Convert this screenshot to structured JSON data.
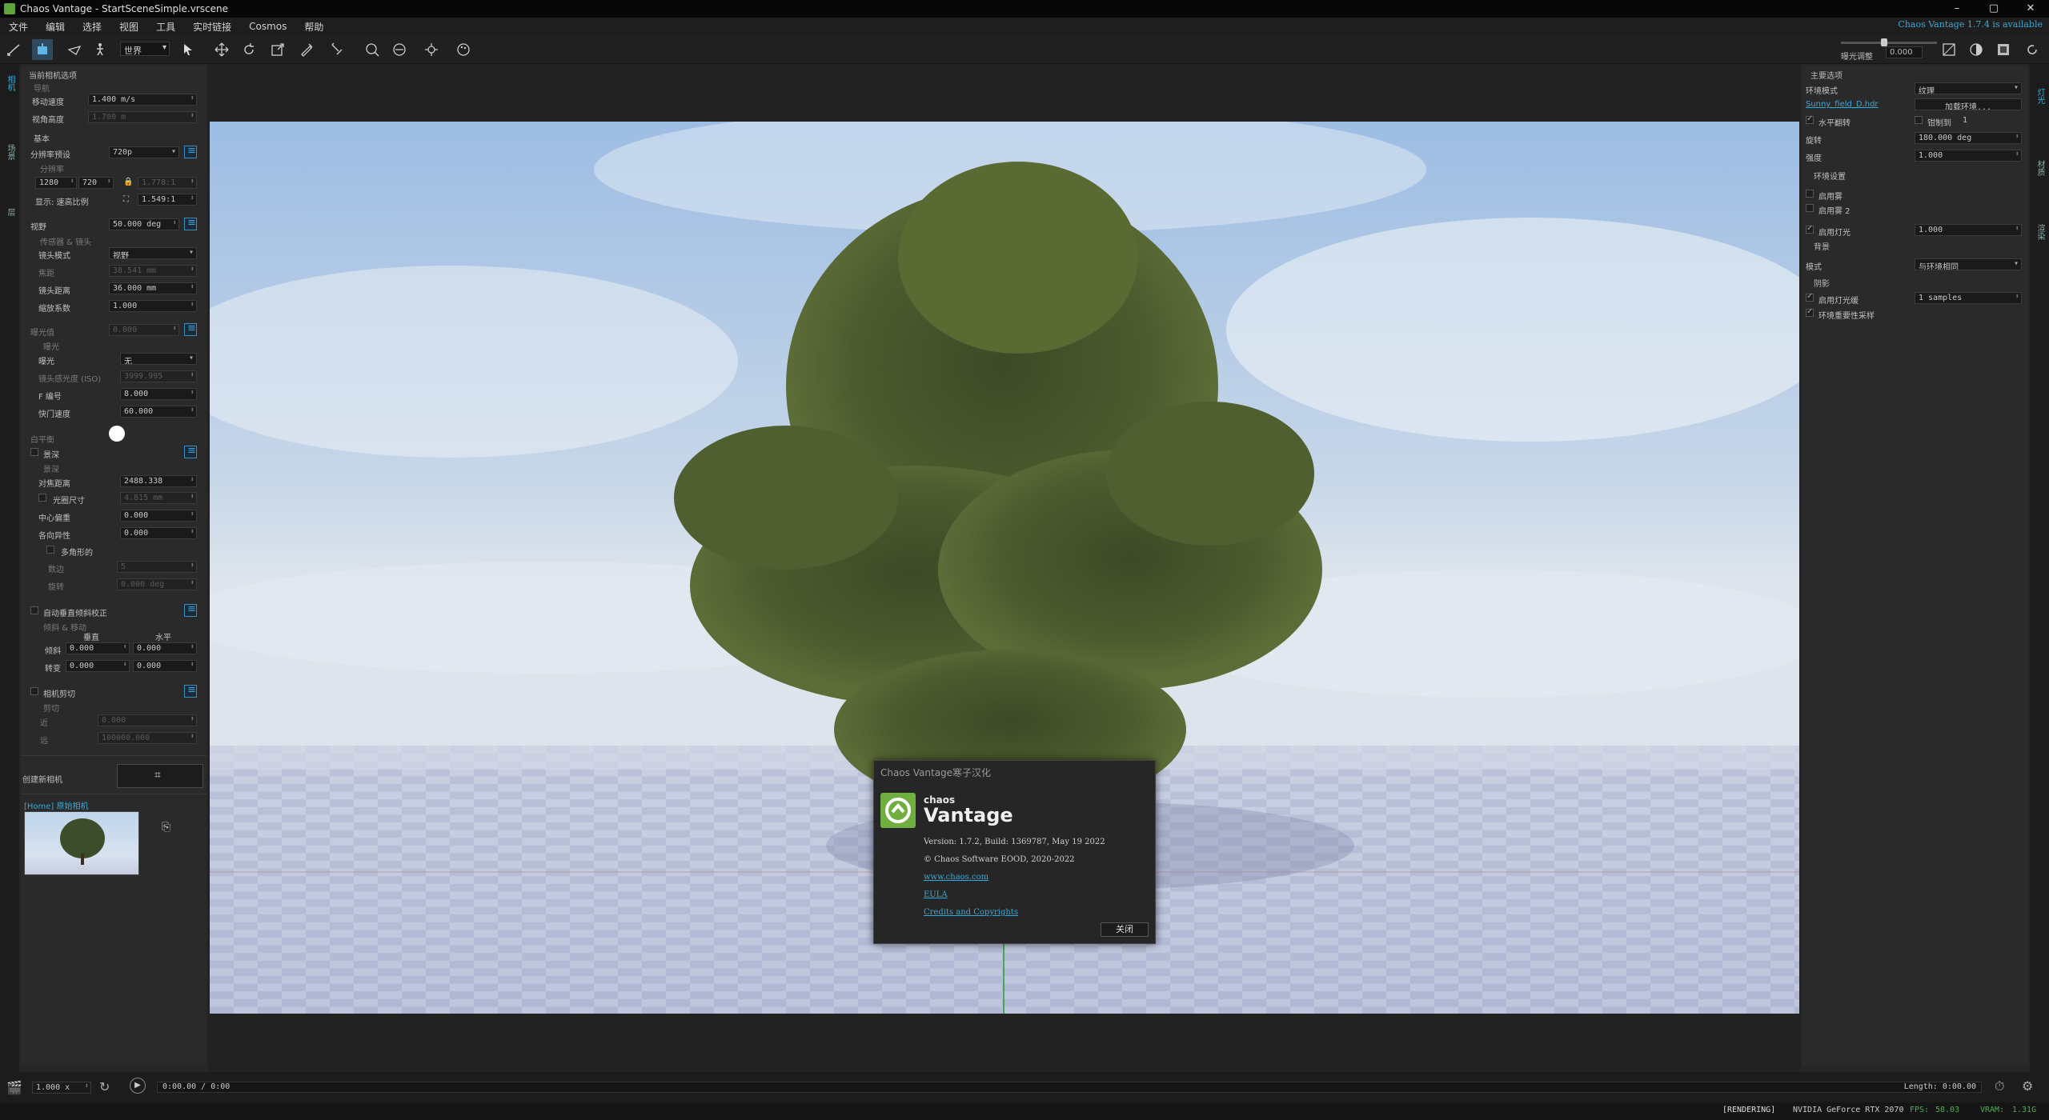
{
  "window": {
    "title": "Chaos Vantage - StartSceneSimple.vrscene",
    "minimize": "–",
    "maximize": "▢",
    "close": "✕"
  },
  "menu": [
    "文件",
    "编辑",
    "选择",
    "视图",
    "工具",
    "实时链接",
    "Cosmos",
    "帮助"
  ],
  "update_notice": "Chaos Vantage 1.7.4 is available",
  "toolbar": {
    "view_select": "世界",
    "exposure_label": "曝光调整",
    "exposure_value": "0.000"
  },
  "left_tabs": [
    "相机",
    "场景",
    "层"
  ],
  "right_tabs": [
    "灯光",
    "材质",
    "渲染"
  ],
  "left_panel": {
    "section_title": "当前相机选项",
    "nav": {
      "header": "导航",
      "move_speed_label": "移动速度",
      "move_speed": "1.400 m/s",
      "view_height_label": "视角高度",
      "view_height": "1.700 m"
    },
    "basic": {
      "header": "基本",
      "res_preset_label": "分辨率预设",
      "res_preset": "720p",
      "res_header": "分辨率",
      "width": "1280",
      "height": "720",
      "ratio": "1.778:1",
      "display_label": "显示: 速高比例",
      "display_ratio": "1.549:1"
    },
    "fov": {
      "label": "视野",
      "value": "50.000 deg"
    },
    "sensor": {
      "header": "传感器 & 镜头",
      "lens_mode_label": "镜头模式",
      "lens_mode": "视野",
      "focal_label": "焦距",
      "focal": "38.541 mm",
      "lens_dist_label": "镜头距离",
      "lens_dist": "36.000 mm",
      "zoom_label": "缩放系数",
      "zoom": "1.000"
    },
    "exposure": {
      "label": "曝光值",
      "value": "0.000",
      "header": "曝光",
      "mode_label": "曝光",
      "mode": "无",
      "iso_label": "镜头感光度 (ISO)",
      "iso": "3999.995",
      "fnum_label": "F 编号",
      "fnum": "8.000",
      "shutter_label": "快门速度",
      "shutter": "60.000"
    },
    "white_balance_label": "白平衡",
    "dof": {
      "toggle_label": "景深",
      "header": "景深",
      "focus_label": "对焦距离",
      "focus": "2488.338",
      "aperture_label": "光圈尺寸",
      "aperture": "4.815 mm",
      "center_label": "中心偏重",
      "center": "0.000",
      "aniso_label": "各向异性",
      "aniso": "0.000",
      "poly_label": "多角形的",
      "sides_label": "数边",
      "sides": "5",
      "rot_label": "旋转",
      "rot": "0.000 deg"
    },
    "vert": {
      "toggle_label": "自动垂直倾斜校正",
      "header": "倾斜 & 移动",
      "col_v": "垂直",
      "col_h": "水平",
      "tilt_label": "倾斜",
      "tilt_v": "0.000",
      "tilt_h": "0.000",
      "shift_label": "转变",
      "shift_v": "0.000",
      "shift_h": "0.000"
    },
    "clip": {
      "toggle_label": "相机剪切",
      "header": "剪切",
      "near_label": "近",
      "near": "0.000",
      "far_label": "远",
      "far": "100000.000"
    },
    "new_camera_label": "创建新相机",
    "camera_list_title": "[Home] 原始相机"
  },
  "right_panel": {
    "section_title": "主要选项",
    "env_mode_label": "环境模式",
    "env_mode": "纹理",
    "hdr_file": "Sunny_field_D.hdr",
    "load_env": "加载环境...",
    "hflip_label": "水平翻转",
    "clamp_label": "钳制到",
    "clamp_value": "1",
    "rotation_label": "旋转",
    "rotation": "180.000 deg",
    "intensity_label": "强度",
    "intensity": "1.000",
    "env_settings": "环境设置",
    "fog_label": "启用雾",
    "fog2_label": "启用雾 2",
    "sun_label": "启用灯光",
    "sun_value": "1.000",
    "bg_header": "背景",
    "bg_mode_label": "模式",
    "bg_mode": "与环境相同",
    "shadow_header": "阴影",
    "light_cache_label": "启用灯光缓",
    "light_cache_value": "1 samples",
    "env_importance_label": "环境重要性采样"
  },
  "about": {
    "title": "Chaos Vantage寒子汉化",
    "brand_small": "chaos",
    "brand": "Vantage",
    "version": "Version: 1.7.2,    Build: 1369787,    May 19 2022",
    "copyright": "© Chaos Software EOOD, 2020-2022",
    "site": "www.chaos.com",
    "eula": "EULA",
    "credits": "Credits and Copyrights",
    "close": "关闭"
  },
  "timeline": {
    "speed": "1.000 x",
    "time": "0:00.00 / 0:00",
    "length": "Length: 0:00.00"
  },
  "status": {
    "state": "[RENDERING]",
    "gpu": "NVIDIA GeForce RTX 2070",
    "fps_label": "FPS:",
    "fps": "58.03",
    "vram_label": "VRAM:",
    "vram": "1.31G"
  },
  "colors": {
    "accent": "#3aa9d8",
    "brand_green": "#6fae3f",
    "sky": "#a9c6e6",
    "ground": "#b8bfd6"
  }
}
